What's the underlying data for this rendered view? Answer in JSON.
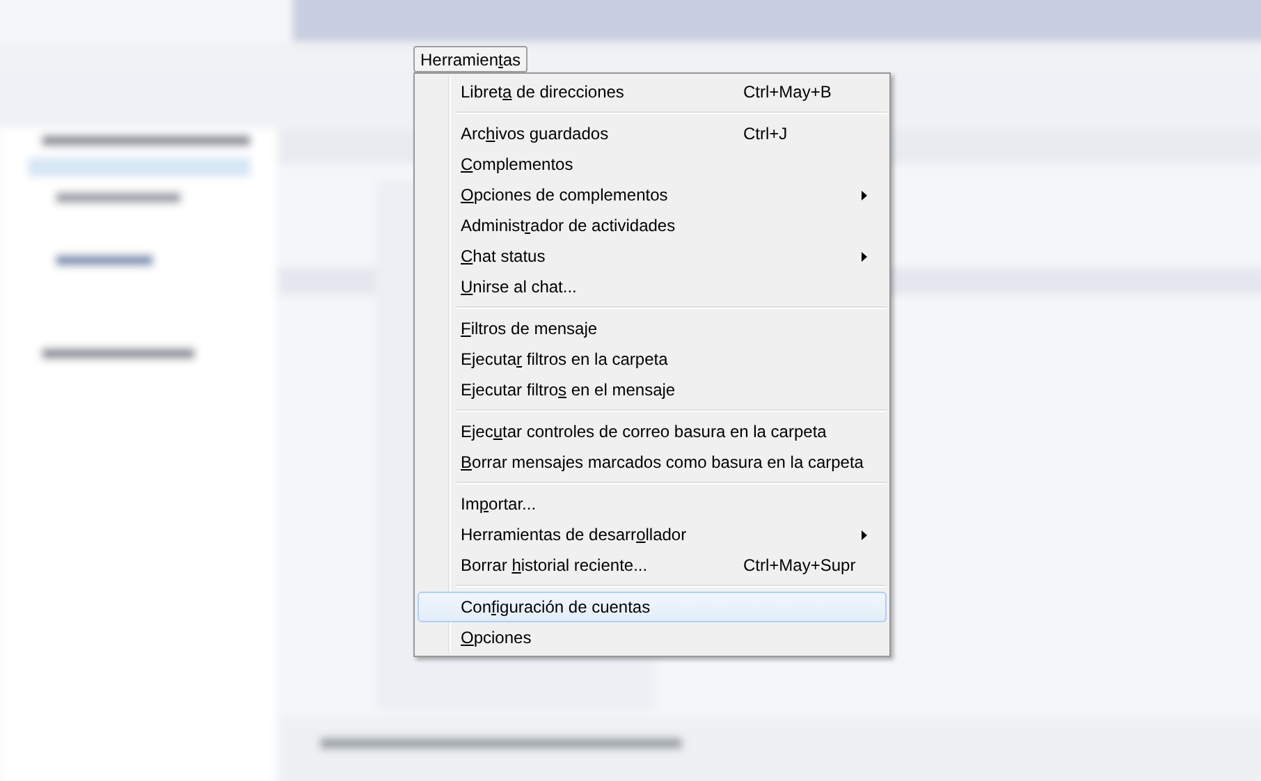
{
  "menu_bar_item": {
    "label": {
      "pre": "Herramien",
      "key": "t",
      "post": "as"
    },
    "selected": true
  },
  "menu": [
    {
      "kind": "item",
      "label": {
        "pre": "Libret",
        "key": "a",
        "post": " de direcciones"
      },
      "shortcut": "Ctrl+May+B",
      "submenu": false,
      "selected": false
    },
    {
      "kind": "separator"
    },
    {
      "kind": "item",
      "label": {
        "pre": "Arc",
        "key": "h",
        "post": "ivos guardados"
      },
      "shortcut": "Ctrl+J",
      "submenu": false,
      "selected": false
    },
    {
      "kind": "item",
      "label": {
        "key": "C",
        "post": "omplementos"
      },
      "submenu": false,
      "selected": false
    },
    {
      "kind": "item",
      "label": {
        "key": "O",
        "post": "pciones de complementos"
      },
      "submenu": true,
      "selected": false
    },
    {
      "kind": "item",
      "label": {
        "pre": "Administ",
        "key": "r",
        "post": "ador de actividades"
      },
      "submenu": false,
      "selected": false
    },
    {
      "kind": "item",
      "label": {
        "key": "C",
        "post": "hat status"
      },
      "submenu": true,
      "selected": false
    },
    {
      "kind": "item",
      "label": {
        "key": "U",
        "post": "nirse al chat..."
      },
      "submenu": false,
      "selected": false
    },
    {
      "kind": "separator"
    },
    {
      "kind": "item",
      "label": {
        "key": "F",
        "post": "iltros de mensaje"
      },
      "submenu": false,
      "selected": false
    },
    {
      "kind": "item",
      "label": {
        "pre": "Ejecuta",
        "key": "r",
        "post": " filtros en la carpeta"
      },
      "submenu": false,
      "selected": false
    },
    {
      "kind": "item",
      "label": {
        "pre": "Ejecutar filtro",
        "key": "s",
        "post": " en el mensaje"
      },
      "submenu": false,
      "selected": false
    },
    {
      "kind": "separator"
    },
    {
      "kind": "item",
      "label": {
        "pre": "Ejec",
        "key": "u",
        "post": "tar controles de correo basura en la carpeta"
      },
      "submenu": false,
      "selected": false
    },
    {
      "kind": "item",
      "label": {
        "key": "B",
        "post": "orrar mensajes marcados como basura en la carpeta"
      },
      "submenu": false,
      "selected": false
    },
    {
      "kind": "separator"
    },
    {
      "kind": "item",
      "label": {
        "pre": "Im",
        "key": "p",
        "post": "ortar..."
      },
      "submenu": false,
      "selected": false
    },
    {
      "kind": "item",
      "label": {
        "pre": "Herramientas de desarr",
        "key": "o",
        "post": "llador"
      },
      "submenu": true,
      "selected": false
    },
    {
      "kind": "item",
      "label": {
        "pre": "Borrar ",
        "key": "h",
        "post": "istorial reciente..."
      },
      "shortcut": "Ctrl+May+Supr",
      "submenu": false,
      "selected": false
    },
    {
      "kind": "separator"
    },
    {
      "kind": "item",
      "label": {
        "pre": "Con",
        "key": "f",
        "post": "iguración de cuentas"
      },
      "submenu": false,
      "selected": true
    },
    {
      "kind": "item",
      "label": {
        "key": "O",
        "post": "pciones"
      },
      "submenu": false,
      "selected": false
    }
  ]
}
